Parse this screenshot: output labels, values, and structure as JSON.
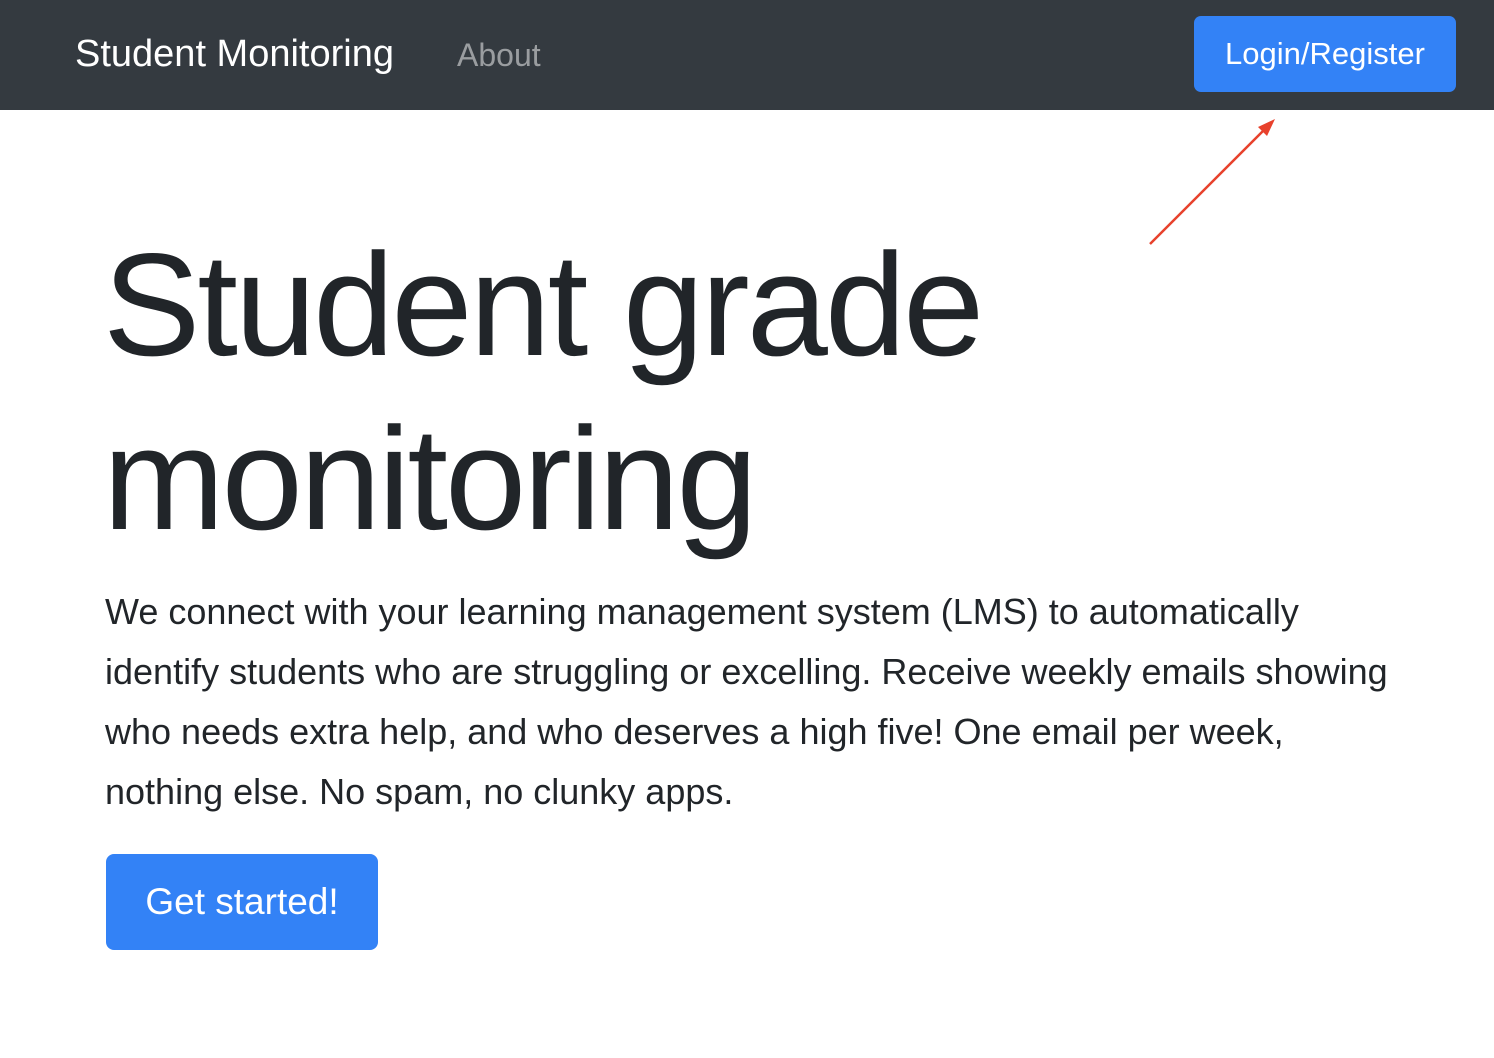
{
  "navbar": {
    "brand": "Student Monitoring",
    "links": [
      {
        "label": "About"
      }
    ],
    "login_button": "Login/Register",
    "background_color": "#343a40"
  },
  "hero": {
    "title": "Student grade monitoring",
    "lead": "We connect with your learning management system (LMS) to automatically identify students who are struggling or excelling. Receive weekly emails showing who needs extra help, and who deserves a high five! One email per week, nothing else. No spam, no clunky apps.",
    "cta_button": "Get started!"
  },
  "annotation": {
    "icon": "red-arrow-icon",
    "color": "#e8412c"
  },
  "colors": {
    "primary": "#3382f6",
    "text": "#212529"
  }
}
